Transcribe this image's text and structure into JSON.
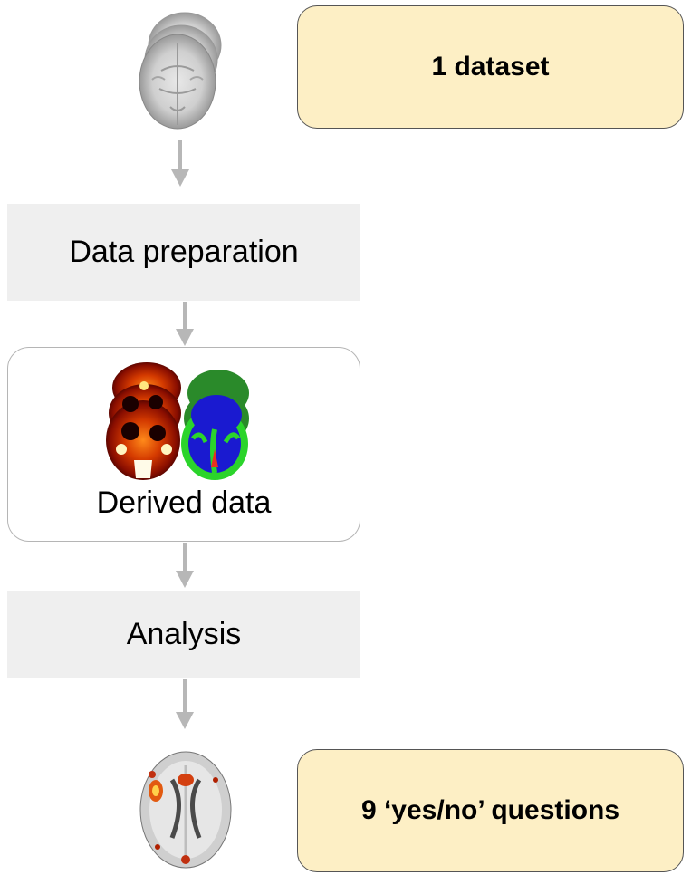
{
  "notes": {
    "top": "1 dataset",
    "bottom": "9 ‘yes/no’ questions"
  },
  "steps": {
    "preparation": "Data preparation",
    "derived": "Derived data",
    "analysis": "Analysis"
  },
  "colors": {
    "note_fill": "#fdefc5",
    "step_fill": "#efefef",
    "arrow": "#b7b7b7"
  }
}
